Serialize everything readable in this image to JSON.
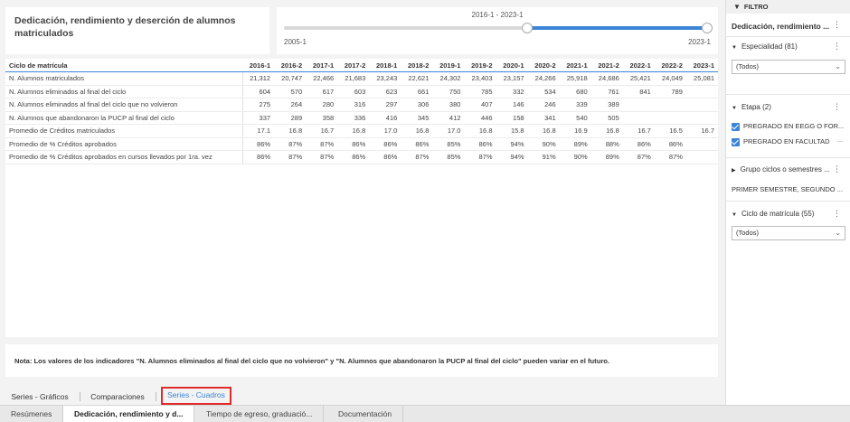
{
  "title": "Dedicación, rendimiento y deserción de alumnos matriculados",
  "slider": {
    "range_label": "2016-1 - 2023-1",
    "min_label": "2005-1",
    "max_label": "2023-1",
    "start_fraction": 0.575,
    "end_fraction": 1.0
  },
  "table": {
    "headers": [
      "Ciclo de matrícula",
      "2016-1",
      "2016-2",
      "2017-1",
      "2017-2",
      "2018-1",
      "2018-2",
      "2019-1",
      "2019-2",
      "2020-1",
      "2020-2",
      "2021-1",
      "2021-2",
      "2022-1",
      "2022-2",
      "2023-1"
    ],
    "rows": [
      [
        "N. Alumnos matriculados",
        "21,312",
        "20,747",
        "22,466",
        "21,683",
        "23,243",
        "22,621",
        "24,302",
        "23,403",
        "23,157",
        "24,266",
        "25,918",
        "24,686",
        "25,421",
        "24,049",
        "25,081"
      ],
      [
        "N. Alumnos eliminados al final del ciclo",
        "604",
        "570",
        "617",
        "603",
        "623",
        "661",
        "750",
        "785",
        "332",
        "534",
        "680",
        "761",
        "841",
        "789",
        ""
      ],
      [
        "N. Alumnos eliminados al final del ciclo que no volvieron",
        "275",
        "264",
        "280",
        "316",
        "297",
        "306",
        "380",
        "407",
        "146",
        "246",
        "339",
        "389",
        "",
        "",
        ""
      ],
      [
        "N. Alumnos que abandonaron la PUCP al final del ciclo",
        "337",
        "289",
        "358",
        "336",
        "416",
        "345",
        "412",
        "446",
        "158",
        "341",
        "540",
        "505",
        "",
        "",
        ""
      ],
      [
        "Promedio de Créditos matriculados",
        "17.1",
        "16.8",
        "16.7",
        "16.8",
        "17.0",
        "16.8",
        "17.0",
        "16.8",
        "15.8",
        "16.8",
        "16.9",
        "16.8",
        "16.7",
        "16.5",
        "16.7"
      ],
      [
        "Promedio de % Créditos aprobados",
        "86%",
        "87%",
        "87%",
        "86%",
        "86%",
        "86%",
        "85%",
        "86%",
        "94%",
        "90%",
        "89%",
        "88%",
        "86%",
        "86%",
        ""
      ],
      [
        "Promedio de % Créditos aprobados en cursos llevados por 1ra. vez",
        "86%",
        "87%",
        "87%",
        "86%",
        "86%",
        "87%",
        "85%",
        "87%",
        "94%",
        "91%",
        "90%",
        "89%",
        "87%",
        "87%",
        ""
      ]
    ]
  },
  "note": "Nota: Los valores de los indicadores \"N. Alumnos eliminados al final del ciclo que no volvieron\"  y \"N. Alumnos que abandonaron la PUCP al final del ciclo\" pueden variar en el futuro.",
  "page_tabs": [
    "Series - Gráficos",
    "Comparaciones",
    "Series - Cuadros"
  ],
  "sheet_tabs": [
    "Resúmenes",
    "Dedicación, rendimiento y d...",
    "Tiempo de egreso, graduació...",
    "Documentación"
  ],
  "filter": {
    "header": "FILTRO",
    "title": "Dedicación, rendimiento ...",
    "especialidad": {
      "label": "Especialidad (81)",
      "value": "(Todos)"
    },
    "etapa": {
      "label": "Etapa (2)",
      "options": [
        "PREGRADO EN EEGG O FOR...",
        "PREGRADO EN FACULTAD"
      ]
    },
    "grupo": {
      "label": "Grupo ciclos o semestres ...",
      "value": "PRIMER SEMESTRE, SEGUNDO ..."
    },
    "ciclo": {
      "label": "Ciclo de matrícula (55)",
      "value": "(Todos)"
    }
  },
  "icons": {
    "filter": "funnel-icon",
    "menu": "kebab-icon",
    "expand": "triangle-down-icon",
    "collapsed": "triangle-right-icon",
    "dropdown": "chevron-down-icon",
    "check": "checkbox-checked-icon"
  },
  "colors": {
    "accent": "#3b84d6",
    "highlight": "#e02b2b"
  }
}
